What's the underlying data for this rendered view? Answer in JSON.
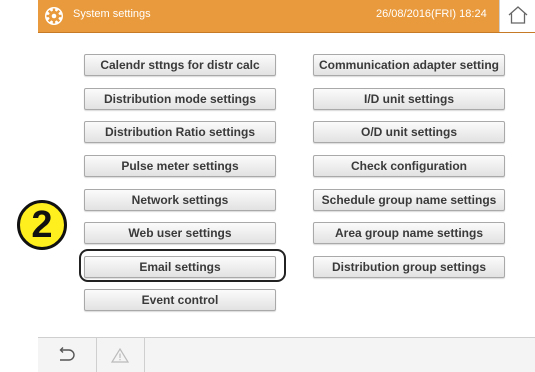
{
  "header": {
    "title": "System settings",
    "datetime": "26/08/2016(FRI) 18:24",
    "title_icon": "gear-icon",
    "home_icon": "home-icon"
  },
  "settings": {
    "left": [
      "Calendr sttngs for distr calc",
      "Distribution mode settings",
      "Distribution Ratio settings",
      "Pulse meter settings",
      "Network settings",
      "Web user settings",
      "Email settings",
      "Event control"
    ],
    "right": [
      "Communication adapter setting",
      "I/D unit settings",
      "O/D unit settings",
      "Check configuration",
      "Schedule group name settings",
      "Area group name settings",
      "Distribution group settings"
    ]
  },
  "annotation": {
    "step": "2"
  },
  "footer": {
    "back_icon": "back-icon",
    "warning_icon": "warning-icon"
  },
  "colors": {
    "titlebar": "#e99a3c",
    "callout": "#ffef1f"
  }
}
